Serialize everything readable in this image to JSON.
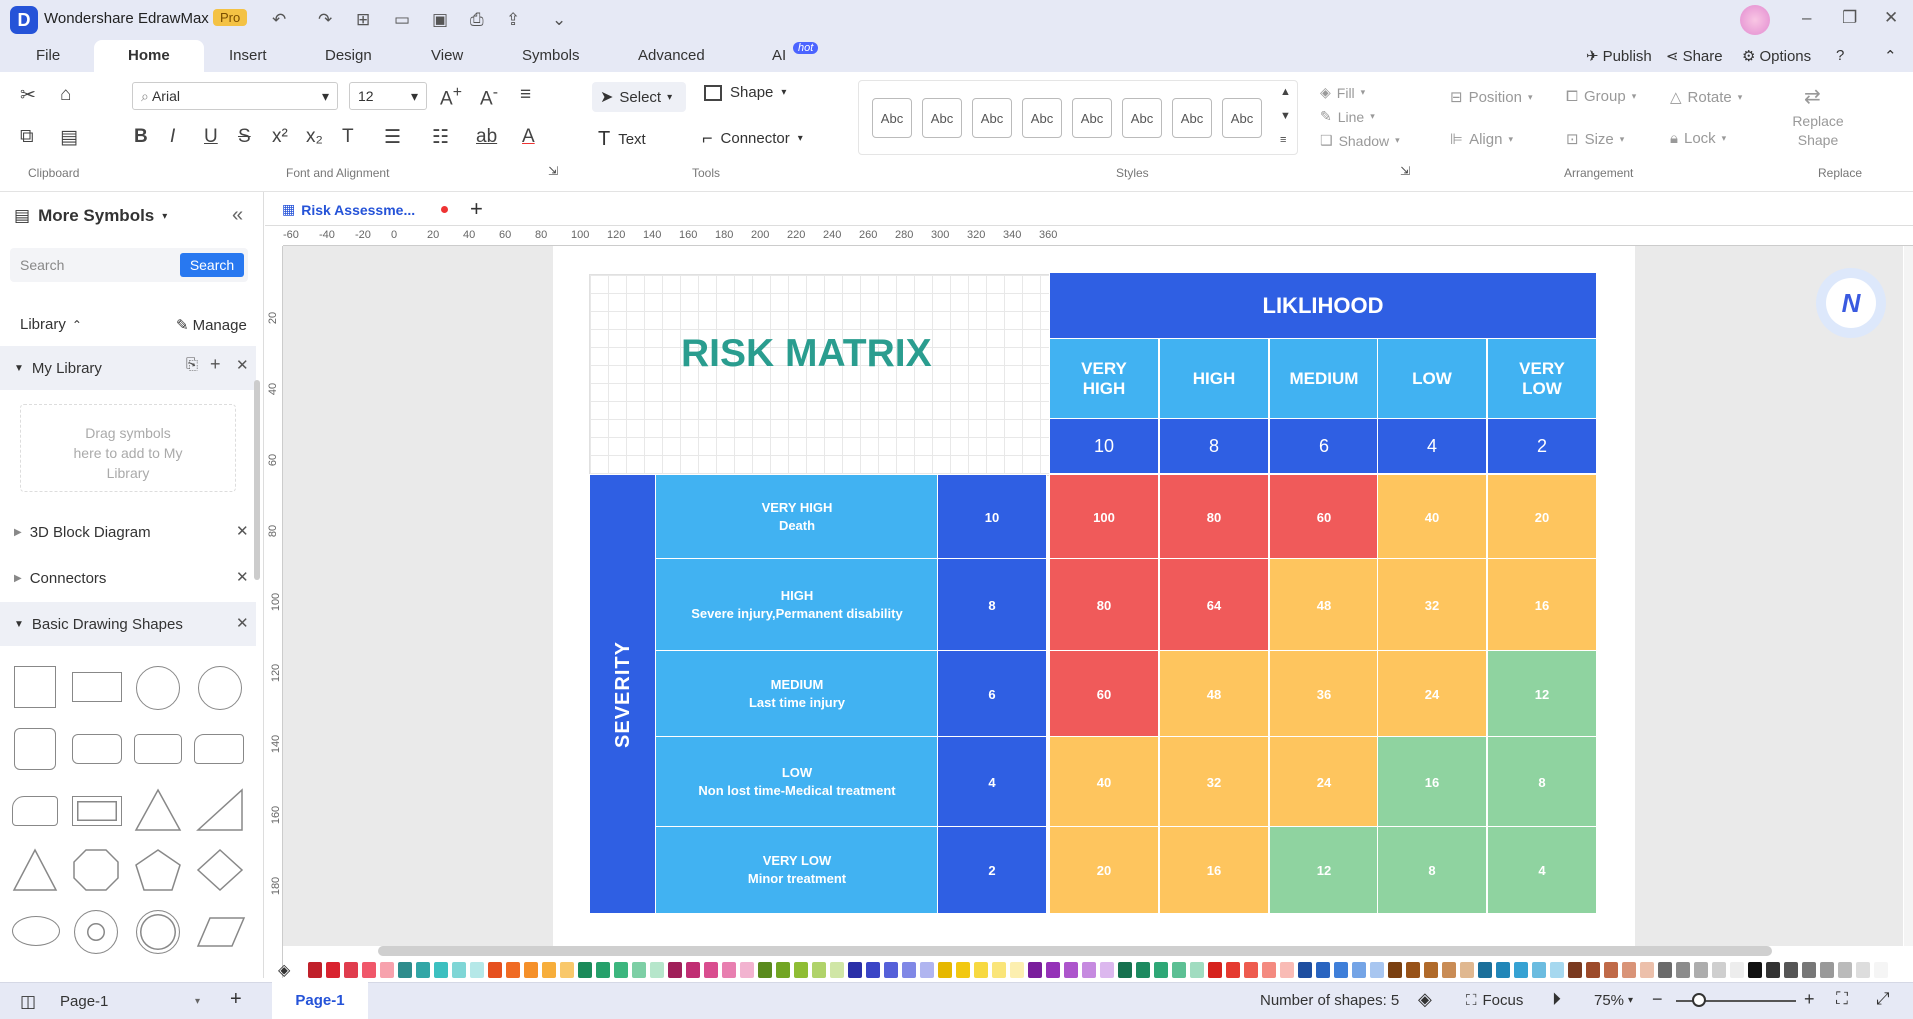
{
  "app": {
    "title": "Wondershare EdrawMax",
    "badge": "Pro"
  },
  "menu": {
    "items": [
      "File",
      "Home",
      "Insert",
      "Design",
      "View",
      "Symbols",
      "Advanced",
      "AI"
    ],
    "hot": "hot",
    "publish": "Publish",
    "share": "Share",
    "options": "Options"
  },
  "ribbon": {
    "font_name": "Arial",
    "font_size": "12",
    "select": "Select",
    "shape": "Shape",
    "text": "Text",
    "connector": "Connector",
    "style_swatches": [
      "Abc",
      "Abc",
      "Abc",
      "Abc",
      "Abc",
      "Abc",
      "Abc",
      "Abc"
    ],
    "fill": "Fill",
    "line": "Line",
    "shadow": "Shadow",
    "position": "Position",
    "group": "Group",
    "rotate": "Rotate",
    "align": "Align",
    "size": "Size",
    "lock": "Lock",
    "replace1": "Replace",
    "replace2": "Shape",
    "groups": [
      "Clipboard",
      "Font and Alignment",
      "Tools",
      "Styles",
      "Arrangement",
      "Replace"
    ]
  },
  "sidebar": {
    "title": "More Symbols",
    "search_placeholder": "Search",
    "search_btn": "Search",
    "library": "Library",
    "manage": "Manage",
    "my_library": "My Library",
    "drop_hint": "Drag symbols here to add to My Library",
    "sections": [
      "3D Block Diagram",
      "Connectors",
      "Basic Drawing Shapes"
    ]
  },
  "tab": {
    "name": "Risk Assessme..."
  },
  "ruler": {
    "h": [
      "-60",
      "-40",
      "-20",
      "0",
      "20",
      "40",
      "60",
      "80",
      "100",
      "120",
      "140",
      "160",
      "180",
      "200",
      "220",
      "240",
      "260",
      "280",
      "300",
      "320",
      "340",
      "360"
    ],
    "v": [
      "20",
      "40",
      "60",
      "80",
      "100",
      "120",
      "140",
      "160",
      "180"
    ]
  },
  "matrix": {
    "title": "RISK MATRIX",
    "likelihood": "LIKLIHOOD",
    "severity": "SEVERITY",
    "cols": [
      {
        "label": "VERY HIGH",
        "score": "10"
      },
      {
        "label": "HIGH",
        "score": "8"
      },
      {
        "label": "MEDIUM",
        "score": "6"
      },
      {
        "label": "LOW",
        "score": "4"
      },
      {
        "label": "VERY LOW",
        "score": "2"
      }
    ],
    "rows": [
      {
        "label": "VERY HIGH",
        "desc": "Death",
        "score": "10",
        "values": [
          "100",
          "80",
          "60",
          "40",
          "20"
        ],
        "levels": [
          "r",
          "r",
          "r",
          "y",
          "y"
        ]
      },
      {
        "label": "HIGH",
        "desc": "Severe injury,Permanent disability",
        "score": "8",
        "values": [
          "80",
          "64",
          "48",
          "32",
          "16"
        ],
        "levels": [
          "r",
          "r",
          "y",
          "y",
          "y"
        ]
      },
      {
        "label": "MEDIUM",
        "desc": "Last time injury",
        "score": "6",
        "values": [
          "60",
          "48",
          "36",
          "24",
          "12"
        ],
        "levels": [
          "r",
          "y",
          "y",
          "y",
          "g"
        ]
      },
      {
        "label": "LOW",
        "desc": "Non lost time-Medical treatment",
        "score": "4",
        "values": [
          "40",
          "32",
          "24",
          "16",
          "8"
        ],
        "levels": [
          "y",
          "y",
          "y",
          "g",
          "g"
        ]
      },
      {
        "label": "VERY LOW",
        "desc": "Minor treatment",
        "score": "2",
        "values": [
          "20",
          "16",
          "12",
          "8",
          "4"
        ],
        "levels": [
          "y",
          "y",
          "g",
          "g",
          "g"
        ]
      }
    ],
    "colors": {
      "dark_blue": "#2f5fe3",
      "light_blue": "#41b2f2",
      "red": "#f05a5a",
      "yellow": "#fec55e",
      "green": "#8fd3a0",
      "title": "#2a9d8f"
    }
  },
  "status": {
    "page_sel": "Page-1",
    "page_tab": "Page-1",
    "shapes": "Number of shapes: 5",
    "focus": "Focus",
    "zoom": "75%"
  },
  "palette": [
    "#c0202a",
    "#d9232f",
    "#e03c4d",
    "#f0576a",
    "#f7a2ad",
    "#2e8c8c",
    "#32a6a6",
    "#3cc0c0",
    "#7fd6d6",
    "#b5e8e8",
    "#e6501f",
    "#f06b24",
    "#f5902a",
    "#f7ae3b",
    "#f9c86b",
    "#1b8a5a",
    "#26a06b",
    "#3cb67e",
    "#7dcfa5",
    "#b6e6cb",
    "#a0205a",
    "#c02e73",
    "#d94d8f",
    "#e87fb0",
    "#f2b3d0",
    "#5a8a1e",
    "#72a524",
    "#8fbd34",
    "#b0d36a",
    "#d0e6a6",
    "#2a2fa8",
    "#3a45c6",
    "#5560d9",
    "#8088e6",
    "#b0b5f0",
    "#e6b800",
    "#f2c811",
    "#f7d941",
    "#fae57a",
    "#fcefb0",
    "#7a1e9c",
    "#9532b8",
    "#ad55cc",
    "#c68ae0",
    "#dcb8ee",
    "#17714f",
    "#1d8a60",
    "#2ea776",
    "#5cc094",
    "#a0dcc0",
    "#d6231e",
    "#e53a30",
    "#ee5b4e",
    "#f48a80",
    "#f9bbb5",
    "#1e4ea0",
    "#2964c0",
    "#3f7fd9",
    "#74a4e6",
    "#a8c6f0",
    "#7a4010",
    "#975218",
    "#b06a2a",
    "#c98c55",
    "#e0b890",
    "#1b6f9a",
    "#2186b8",
    "#36a2d3",
    "#6bbce0",
    "#a6d8ef",
    "#7a3a20",
    "#9c4a2a",
    "#c06a48",
    "#d99478",
    "#ecc0ab",
    "#6b6b6b",
    "#8c8c8c",
    "#adadad",
    "#cfcfcf",
    "#ededed",
    "#111111",
    "#333333",
    "#555555",
    "#777777",
    "#999999",
    "#bbbbbb",
    "#dddddd",
    "#f5f5f5"
  ]
}
